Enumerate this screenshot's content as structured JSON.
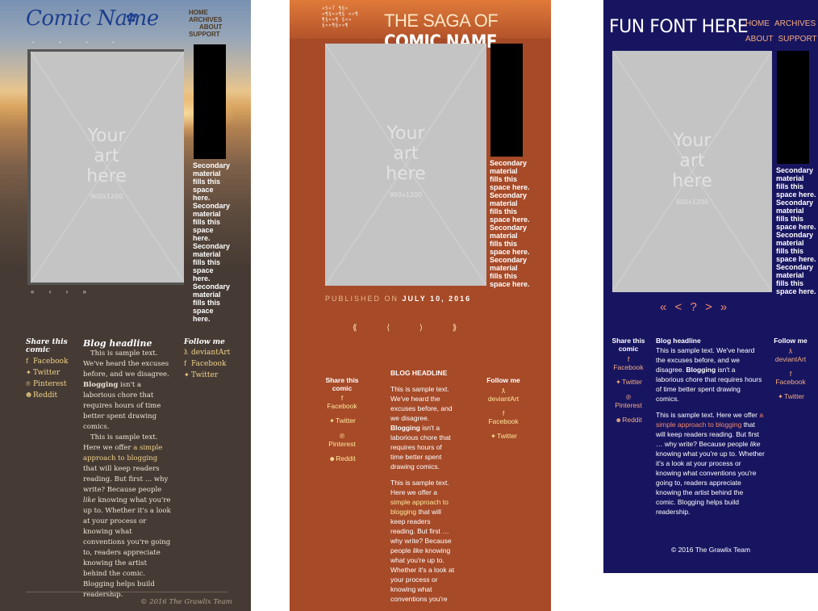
{
  "theme1": {
    "title": "Comic Name",
    "nav": [
      "HOME",
      "ARCHIVES",
      "ABOUT",
      "SUPPORT"
    ],
    "art": {
      "line1": "Your",
      "line2": "art",
      "line3": "here",
      "size": "900x1200"
    },
    "secondary": "Secondary material fills this space here. Secondary material fills this space here. Secondary material fills this space here. Secondary material fills this space here.",
    "pager": [
      "«",
      "‹",
      "›",
      "»"
    ],
    "share_heading": "Share this comic",
    "share_links": [
      "Facebook",
      "Twitter",
      "Pinterest",
      "Reddit"
    ],
    "blog_headline": "Blog headline",
    "follow_heading": "Follow me",
    "follow_links": [
      "deviantArt",
      "Facebook",
      "Twitter"
    ],
    "copyright": "© 2016 The Grawlix Team"
  },
  "theme2": {
    "logo_lines": [
      "«S»T ¶§»",
      "»¶§«»¶§ «»¶",
      "¶§«»¶ §«»",
      "§«»¶§«»¶"
    ],
    "title_small": "THE SAGA OF",
    "title_big": "COMIC NAME",
    "art": {
      "line1": "Your",
      "line2": "art",
      "line3": "here",
      "size": "900x1200"
    },
    "secondary": "Secondary material fills this space here. Secondary material fills this space here. Secondary material fills this space here. Secondary material fills this space here.",
    "published_label": "PUBLISHED ON",
    "published_date": "JULY 10, 2016",
    "pager": [
      "⟪",
      "⟨",
      "⟩",
      "⟫"
    ],
    "share_heading": "Share this comic",
    "share_links": [
      "Facebook",
      "Twitter",
      "Pinterest",
      "Reddit"
    ],
    "blog_headline": "BLOG HEADLINE",
    "follow_heading": "Follow me",
    "follow_links": [
      "deviantArt",
      "Facebook",
      "Twitter"
    ]
  },
  "theme3": {
    "title": "FUN FONT HERE",
    "nav": [
      "HOME",
      "ARCHIVES",
      "ABOUT",
      "SUPPORT"
    ],
    "art": {
      "line1": "Your",
      "line2": "art",
      "line3": "here",
      "size": "900x1200"
    },
    "secondary": "Secondary material fills this space here. Secondary material fills this space here. Secondary material fills this space here. Secondary material fills this space here.",
    "pager": [
      "«",
      "<",
      "?",
      ">",
      "»"
    ],
    "share_heading": "Share this comic",
    "share_links": [
      "Facebook",
      "Twitter",
      "Pinterest",
      "Reddit"
    ],
    "blog_headline": "Blog headline",
    "follow_heading": "Follow me",
    "follow_links": [
      "deviantArt",
      "Facebook",
      "Twitter"
    ],
    "copyright": "© 2016 The Grawlix Team"
  },
  "blog": {
    "p1_a": "This is sample text. We've heard the excuses before, and we disagree. ",
    "p1_bold": "Blogging",
    "p1_b": " isn't a laborious chore that requires hours of time better spent drawing comics.",
    "p2_a": "This is sample text. Here we offer ",
    "p2_link": "a simple approach to blogging",
    "p2_b": " that will keep readers reading. But first … why write? Because people ",
    "p2_em": "like",
    "p2_c": " knowing what you're up to. Whether it's a look at your process or knowing what conventions you're going to, readers appreciate knowing the artist behind the comic. Blogging helps build readership.",
    "p2_link_t2": "simple approach to blogging",
    "p2_a_t2": "This is sample text. Here we offer a ",
    "p2_c_t2": " knowing what you're up to. Whether it's a look at your process or knowing what conventions you're"
  },
  "icons": {
    "facebook": "facebook-icon",
    "twitter": "twitter-icon",
    "pinterest": "pinterest-icon",
    "reddit": "reddit-icon",
    "deviantart": "deviantart-icon"
  },
  "colors": {
    "theme1_bg": "#463b34",
    "theme1_title": "#1e3f8e",
    "theme1_link": "#f0d28a",
    "theme2_bg": "#a64a28",
    "theme2_link": "#ffe79a",
    "theme3_bg": "#181560",
    "theme3_link": "#f3ad7f",
    "placeholder": "#c4c4c4",
    "secondary_box": "#000000"
  }
}
